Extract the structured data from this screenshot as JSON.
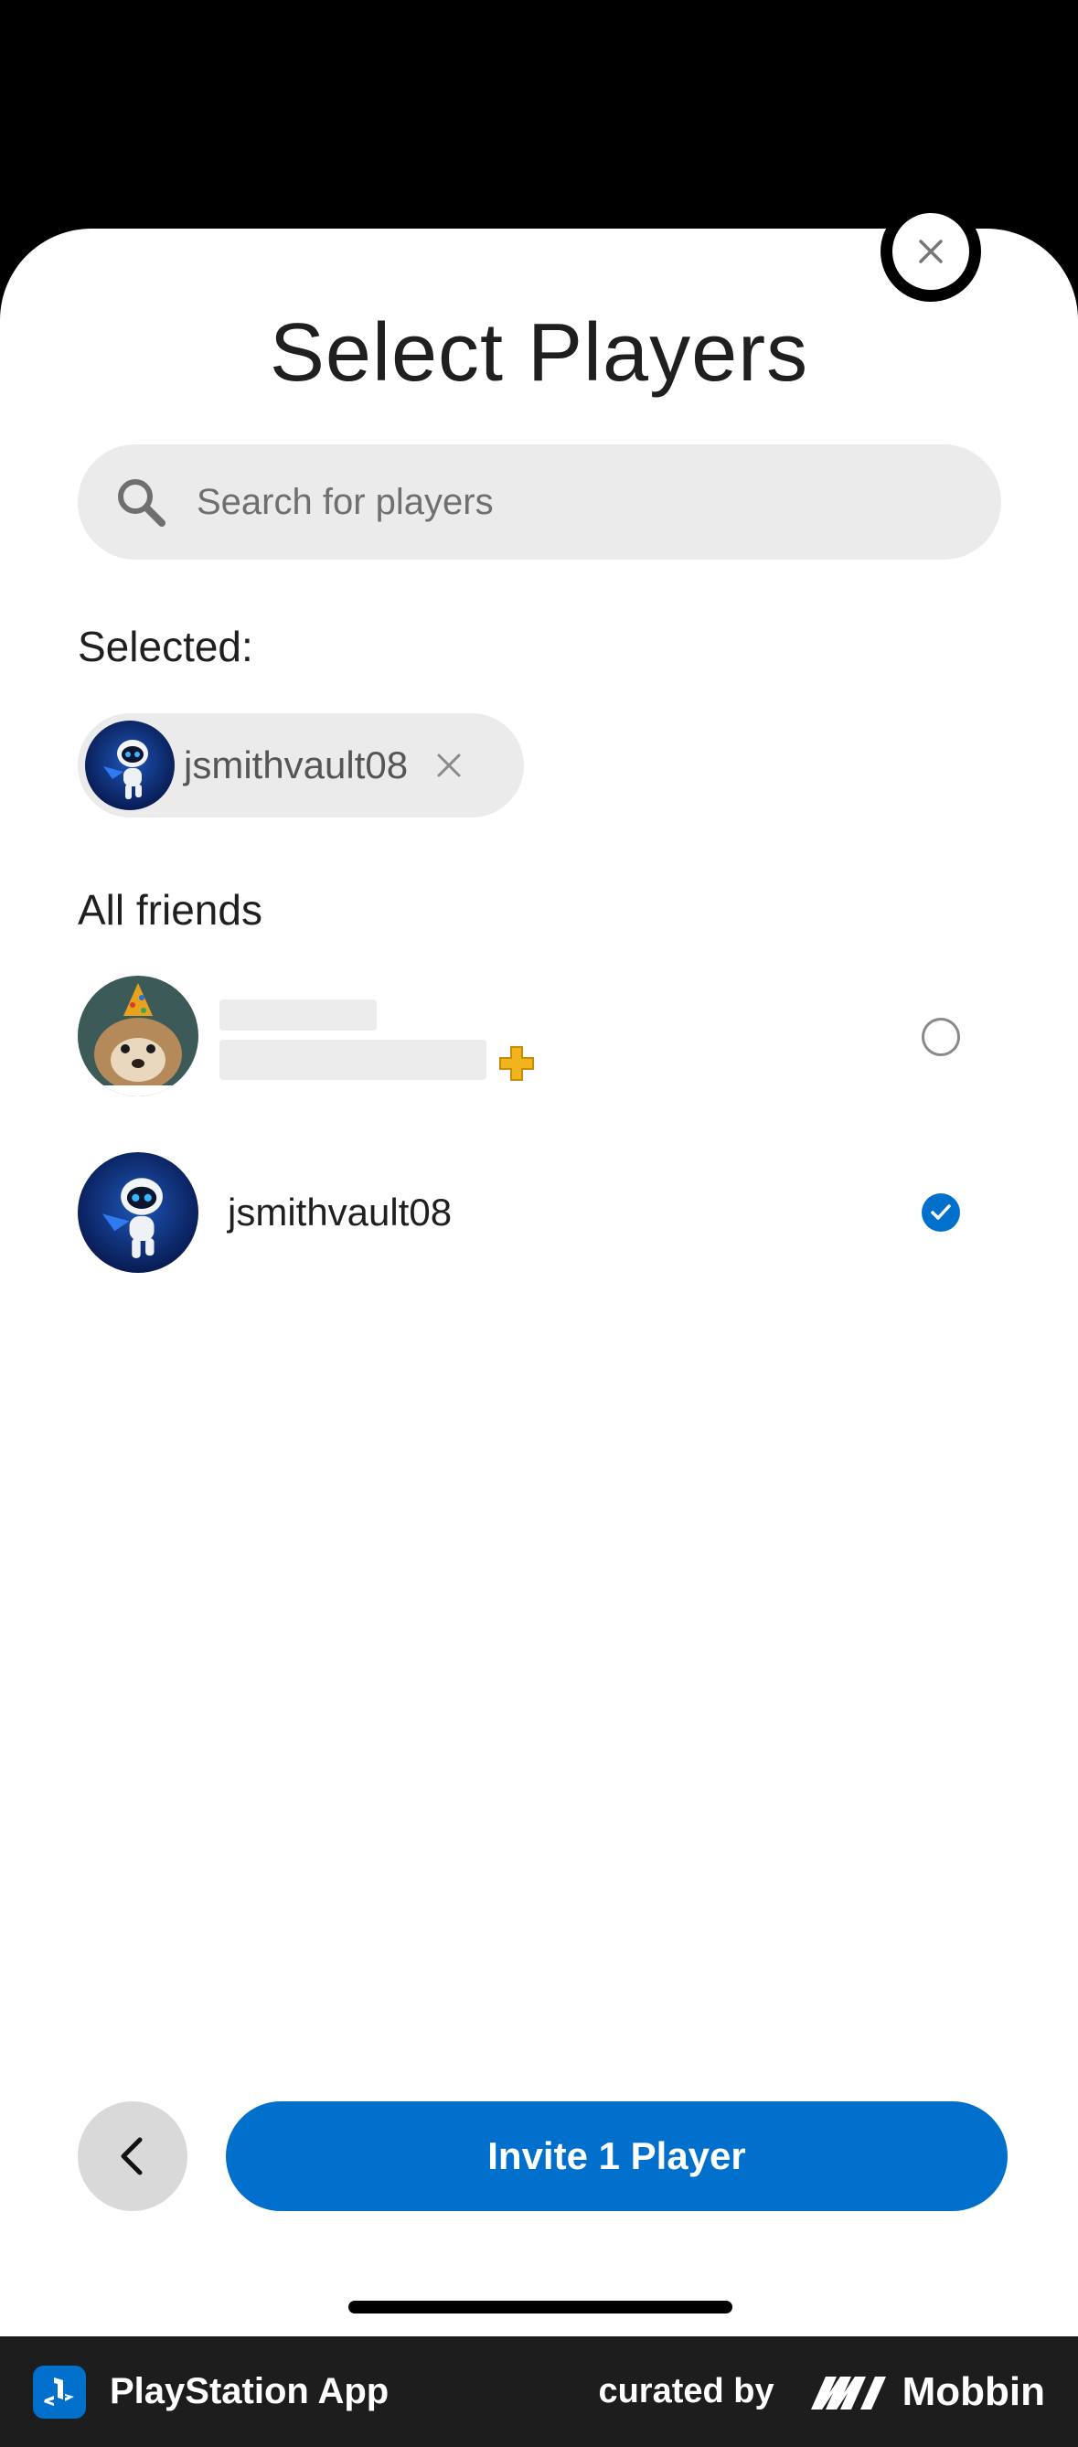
{
  "sheet": {
    "title": "Select Players",
    "search": {
      "placeholder": "Search for players",
      "icon": "search-icon"
    }
  },
  "selected": {
    "label": "Selected:",
    "chips": [
      {
        "name": "jsmithvault08",
        "avatar": "astro-bot-avatar"
      }
    ]
  },
  "friends": {
    "label": "All friends",
    "items": [
      {
        "name": "",
        "avatar": "party-hat-dog-avatar",
        "ps_plus": true,
        "selected": false
      },
      {
        "name": "jsmithvault08",
        "avatar": "astro-bot-avatar",
        "ps_plus": false,
        "selected": true
      }
    ]
  },
  "actions": {
    "invite_label": "Invite 1 Player"
  },
  "footer": {
    "app_name": "PlayStation App",
    "curated_by": "curated by",
    "brand": "Mobbin"
  },
  "colors": {
    "accent": "#0070cc",
    "chip_bg": "#ebebeb",
    "footer_bg": "#1d1d1d"
  }
}
